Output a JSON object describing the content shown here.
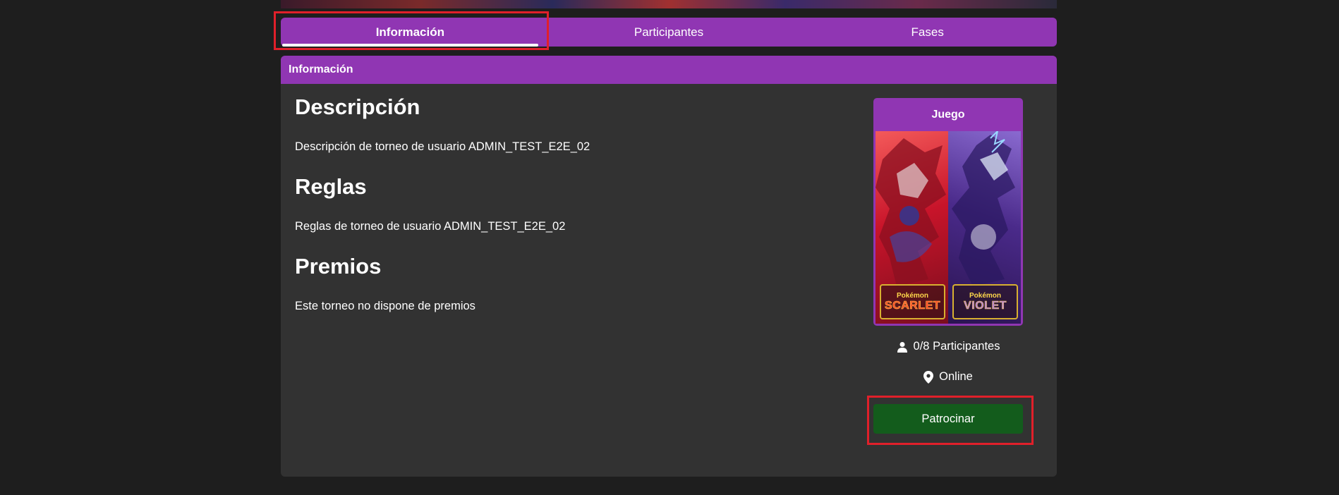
{
  "tabs": [
    {
      "label": "Información",
      "active": true
    },
    {
      "label": "Participantes",
      "active": false
    },
    {
      "label": "Fases",
      "active": false
    }
  ],
  "panel": {
    "header": "Información",
    "sections": [
      {
        "title": "Descripción",
        "text": "Descripción de torneo de usuario ADMIN_TEST_E2E_02"
      },
      {
        "title": "Reglas",
        "text": "Reglas de torneo de usuario ADMIN_TEST_E2E_02"
      },
      {
        "title": "Premios",
        "text": "Este torneo no dispone de premios"
      }
    ]
  },
  "game": {
    "title": "Juego",
    "cover_logo_left_small": "Pokémon",
    "cover_logo_left": "SCARLET",
    "cover_logo_right_small": "Pokémon",
    "cover_logo_right": "VIOLET"
  },
  "meta": {
    "participants": "0/8 Participantes",
    "participants_icon": "person-icon",
    "location": "Online",
    "location_icon": "map-pin-icon"
  },
  "actions": {
    "sponsor_label": "Patrocinar"
  },
  "colors": {
    "accent_purple": "#9036b3",
    "sponsor_green": "#135c1c",
    "highlight_red": "#e0202a",
    "panel_bg": "#323232",
    "page_bg": "#1e1e1e"
  }
}
